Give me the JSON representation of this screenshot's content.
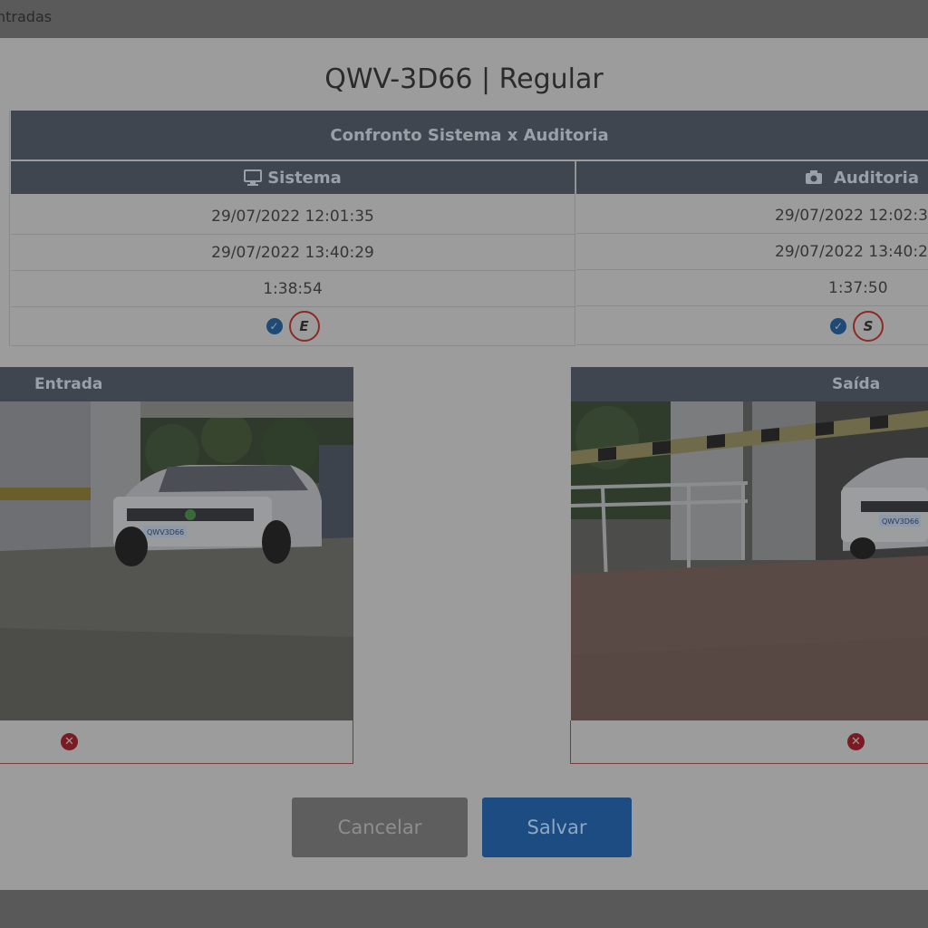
{
  "window": {
    "title_fragment": "ntradas"
  },
  "modal": {
    "title": "QWV-3D66 | Regular"
  },
  "comparison": {
    "header": "Confronto Sistema x Auditoria",
    "system_label": "Sistema",
    "audit_label": "Auditoria",
    "system_icon": "monitor-icon",
    "audit_icon": "camera-icon",
    "rows": {
      "system": [
        "29/07/2022 12:01:35",
        "29/07/2022 13:40:29",
        "1:38:54"
      ],
      "audit": [
        "29/07/2022 12:02:3",
        "29/07/2022 13:40:2",
        "1:37:50"
      ]
    },
    "system_badge": "E",
    "audit_badge": "S"
  },
  "panels": {
    "entry_label": "Entrada",
    "exit_label": "Saída",
    "entry_plate": "QWV3D66",
    "exit_plate": "QWV3D66"
  },
  "buttons": {
    "cancel": "Cancelar",
    "save": "Salvar"
  },
  "colors": {
    "header_bg": "#3f4650",
    "save_bg": "#1c4c82",
    "cancel_bg": "#5e5e5e",
    "error_red": "#7a1a22"
  }
}
